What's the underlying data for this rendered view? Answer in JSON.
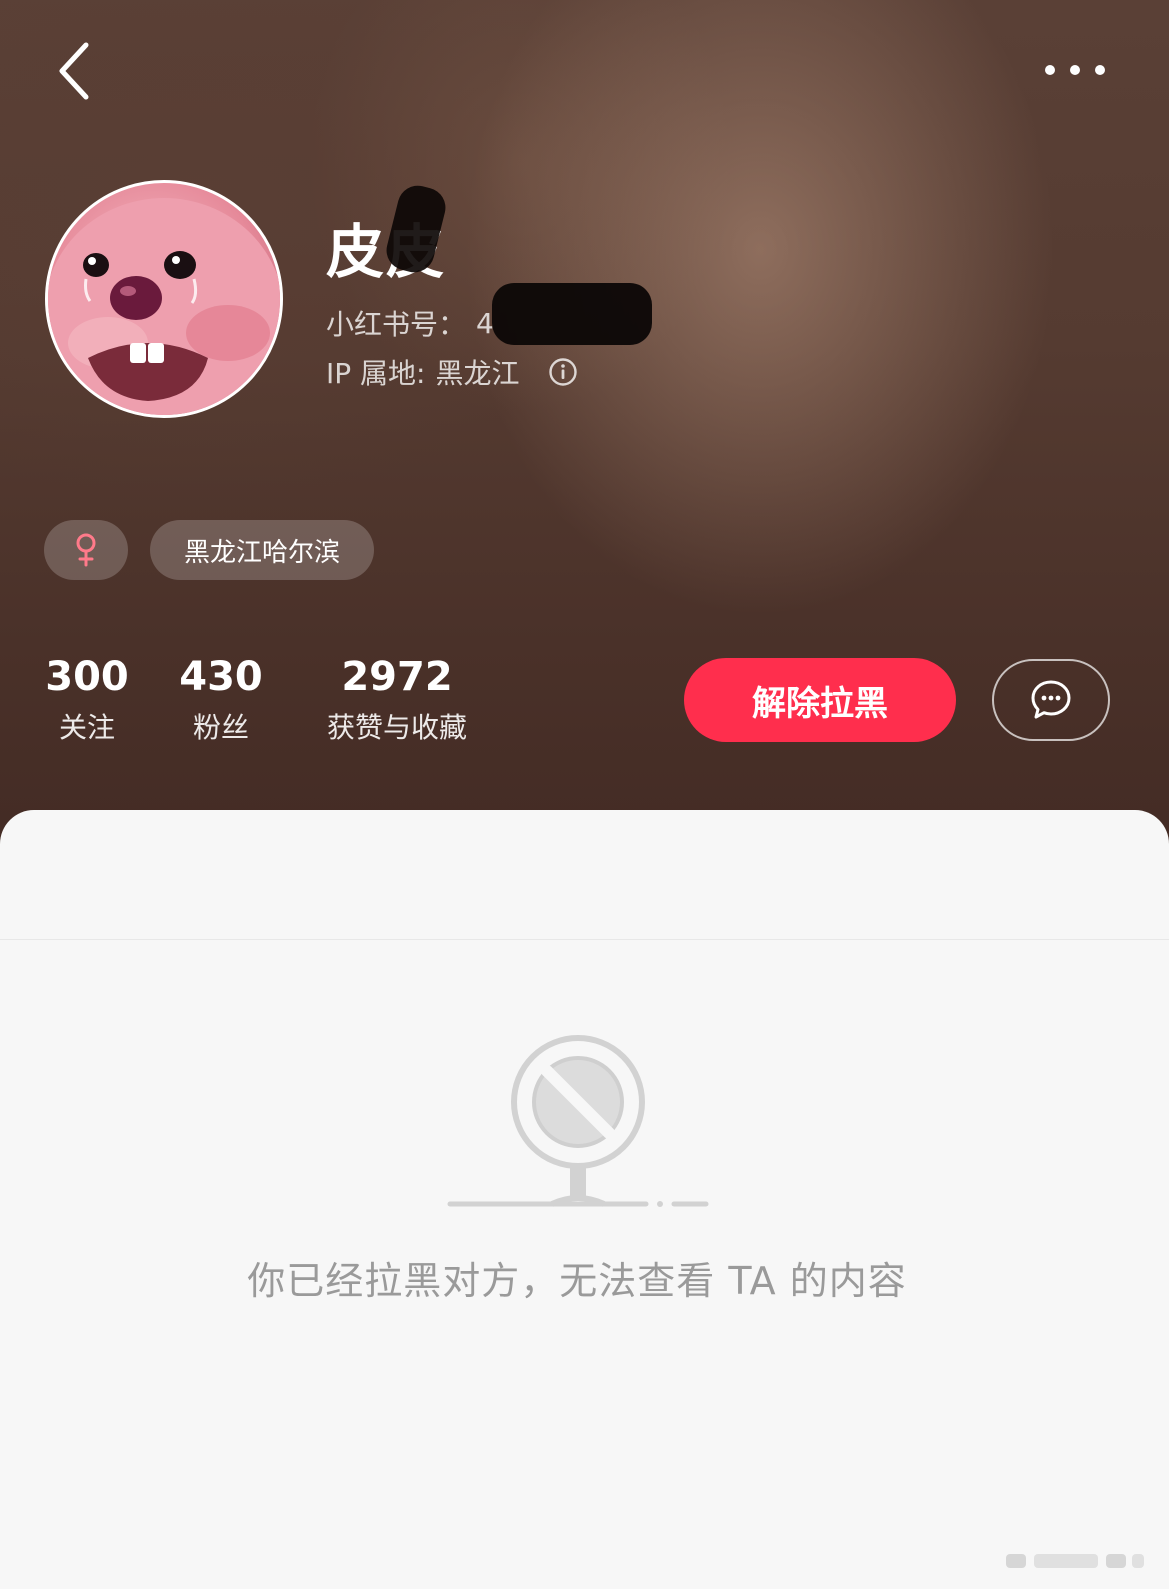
{
  "header": {
    "back_icon": "chevron-left-icon",
    "more_icon": "more-horizontal-icon"
  },
  "profile": {
    "name": "皮皮",
    "id_label": "小红书号：",
    "id_value": "4",
    "ip_label": "IP 属地: ",
    "ip_value": "黑龙江",
    "info_icon": "info-icon",
    "tags": {
      "gender_icon": "female-icon",
      "gender_color": "#ff7a8a",
      "region": "黑龙江哈尔滨"
    }
  },
  "stats": {
    "follow_count": "300",
    "follow_label": "关注",
    "fans_count": "430",
    "fans_label": "粉丝",
    "likes_count": "2972",
    "likes_label": "获赞与收藏"
  },
  "actions": {
    "unblock_label": "解除拉黑",
    "unblock_color": "#ff2e4d",
    "message_icon": "chat-bubble-icon"
  },
  "content": {
    "blocked_icon": "blocked-sign-icon",
    "empty_message": "你已经拉黑对方，无法查看 TA 的内容"
  }
}
